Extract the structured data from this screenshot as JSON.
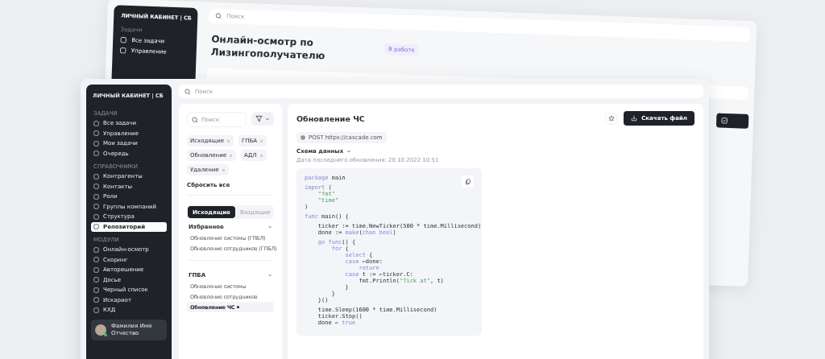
{
  "back_window": {
    "sidebar": {
      "title": "ЛИЧНЫЙ КАБИНЕТ | СБ",
      "section": "Задачи",
      "items": [
        "Все задачи",
        "Управление"
      ]
    },
    "search": {
      "placeholder": "Поиск"
    },
    "title": "Онлайн-осмотр по Лизингополучателю",
    "status": "В работе"
  },
  "sidebar": {
    "title": "ЛИЧНЫЙ КАБИНЕТ | СБ",
    "sections": [
      {
        "label": "ЗАДАЧИ",
        "items": [
          {
            "label": "Все задачи",
            "selected": false
          },
          {
            "label": "Управление",
            "selected": false
          },
          {
            "label": "Мои задачи",
            "selected": false
          },
          {
            "label": "Очередь",
            "selected": false
          }
        ]
      },
      {
        "label": "СПРАВОЧНИКИ",
        "items": [
          {
            "label": "Контрагенты",
            "selected": false
          },
          {
            "label": "Контакты",
            "selected": false
          },
          {
            "label": "Роли",
            "selected": false
          },
          {
            "label": "Группы компаний",
            "selected": false
          },
          {
            "label": "Структура",
            "selected": false
          },
          {
            "label": "Репозиторий",
            "selected": true
          }
        ]
      },
      {
        "label": "МОДУЛИ",
        "items": [
          {
            "label": "Онлайн-осмотр",
            "selected": false
          },
          {
            "label": "Скоринг",
            "selected": false
          },
          {
            "label": "Авторешение",
            "selected": false
          },
          {
            "label": "Досье",
            "selected": false
          },
          {
            "label": "Черный список",
            "selected": false
          },
          {
            "label": "Искариот",
            "selected": false
          },
          {
            "label": "КХД",
            "selected": false
          }
        ]
      }
    ],
    "user": {
      "name": "Фамилия Имя Отчество",
      "online": true
    }
  },
  "search": {
    "placeholder": "Поиск"
  },
  "filters": {
    "search": {
      "placeholder": "Поиск"
    },
    "chips": [
      "Исходящие",
      "ГПБА",
      "Обновление",
      "АДЛ",
      "Удаление"
    ],
    "reset": "Сбросить все",
    "tabs": [
      {
        "label": "Исходящие",
        "selected": true
      },
      {
        "label": "Входящие",
        "selected": false
      }
    ],
    "groups": [
      {
        "label": "Избранное",
        "expanded": true,
        "items": [
          {
            "label": "Обновление системы (ГПБЛ)",
            "selected": false
          },
          {
            "label": "Обновление сотрудников (ГПБЛ)",
            "selected": false
          }
        ]
      },
      {
        "label": "ГПБА",
        "expanded": true,
        "items": [
          {
            "label": "Обновление системы",
            "selected": false
          },
          {
            "label": "Обновление сотрудников",
            "selected": false
          },
          {
            "label": "Обновление ЧС",
            "selected": true
          }
        ]
      }
    ]
  },
  "detail": {
    "title": "Обновление ЧС",
    "download": "Скачать файл",
    "endpoint": "POST https://cascade.com",
    "schema": "Схема данных",
    "updated": "Дата последнего обновления: 20.10.2022 10:51",
    "code": [
      [
        [
          {
            "t": "package",
            "kind": "keyword"
          },
          {
            "t": " main",
            "kind": "plain"
          }
        ]
      ],
      [
        [
          {
            "t": "import",
            "kind": "keyword"
          },
          {
            "t": " (",
            "kind": "plain"
          }
        ],
        [
          {
            "t": "    \"fmt\"",
            "kind": "string"
          }
        ],
        [
          {
            "t": "    \"time\"",
            "kind": "string"
          }
        ],
        [
          {
            "t": ")",
            "kind": "plain"
          }
        ]
      ],
      [
        [
          {
            "t": "func",
            "kind": "keyword"
          },
          {
            "t": " main() {",
            "kind": "plain"
          }
        ]
      ],
      [
        [
          {
            "t": "    ticker := time.NewTicker(500 * time.Millisecond)",
            "kind": "plain"
          }
        ],
        [
          {
            "t": "    done := ",
            "kind": "plain"
          },
          {
            "t": "make",
            "kind": "keyword"
          },
          {
            "t": "(",
            "kind": "plain"
          },
          {
            "t": "chan bool",
            "kind": "keyword"
          },
          {
            "t": ")",
            "kind": "plain"
          }
        ]
      ],
      [
        [
          {
            "t": "    go func",
            "kind": "keyword"
          },
          {
            "t": "() {",
            "kind": "plain"
          }
        ],
        [
          {
            "t": "        for",
            "kind": "keyword"
          },
          {
            "t": " {",
            "kind": "plain"
          }
        ],
        [
          {
            "t": "            select",
            "kind": "keyword"
          },
          {
            "t": " {",
            "kind": "plain"
          }
        ],
        [
          {
            "t": "            case",
            "kind": "keyword"
          },
          {
            "t": " ←done:",
            "kind": "plain"
          }
        ],
        [
          {
            "t": "                return",
            "kind": "keyword"
          }
        ],
        [
          {
            "t": "            case",
            "kind": "keyword"
          },
          {
            "t": " t := ←ticker.C:",
            "kind": "plain"
          }
        ],
        [
          {
            "t": "                fmt.Println(",
            "kind": "plain"
          },
          {
            "t": "\"Tick at\"",
            "kind": "string"
          },
          {
            "t": ", t)",
            "kind": "plain"
          }
        ],
        [
          {
            "t": "            }",
            "kind": "plain"
          }
        ],
        [
          {
            "t": "        }",
            "kind": "plain"
          }
        ],
        [
          {
            "t": "    }()",
            "kind": "plain"
          }
        ]
      ],
      [
        [
          {
            "t": "    time.Sleep(1600 * time.Millisecond)",
            "kind": "plain"
          }
        ],
        [
          {
            "t": "    ticker.Stop()",
            "kind": "plain"
          }
        ],
        [
          {
            "t": "    done ← ",
            "kind": "plain"
          },
          {
            "t": "true",
            "kind": "keyword"
          }
        ]
      ]
    ]
  }
}
